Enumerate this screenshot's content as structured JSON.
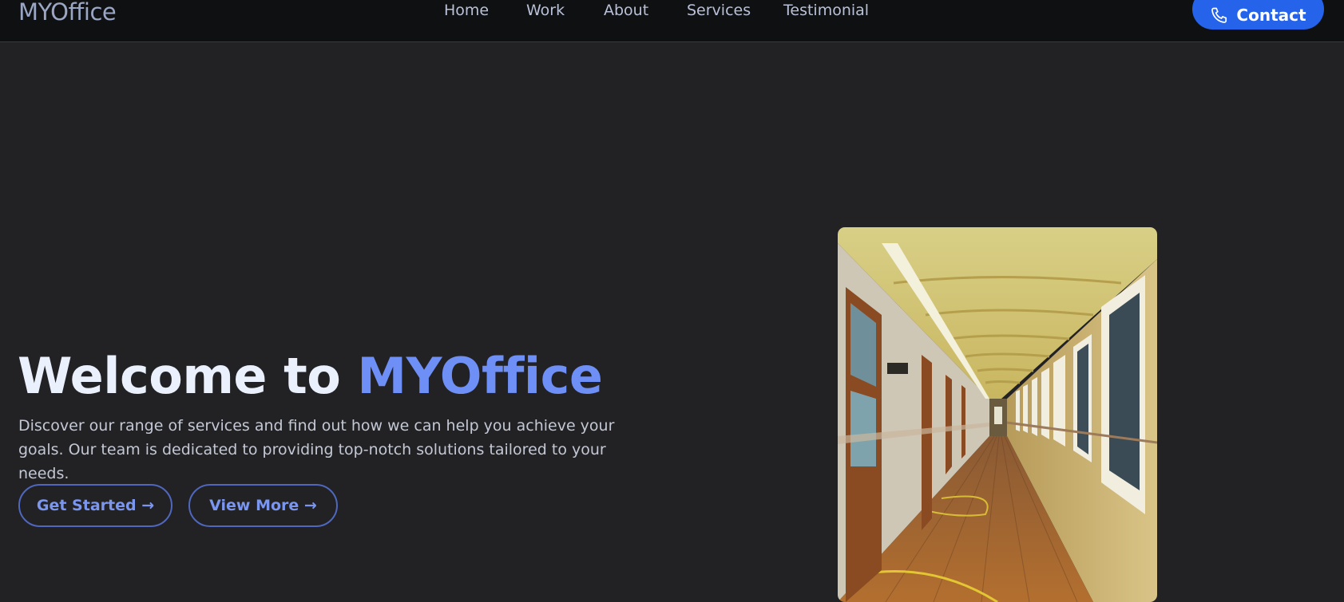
{
  "header": {
    "brand": "MYOffice",
    "nav": [
      {
        "label": "Home"
      },
      {
        "label": "Work"
      },
      {
        "label": "About"
      },
      {
        "label": "Services"
      },
      {
        "label": "Testimonial"
      }
    ],
    "contact_label": "Contact",
    "contact_icon": "phone-icon"
  },
  "hero": {
    "title_prefix": "Welcome to ",
    "title_highlight": "MYOffice",
    "description": "Discover our range of services and find out how we can help you achieve your goals. Our team is dedicated to providing top-notch solutions tailored to your needs.",
    "buttons": [
      {
        "label": "Get Started →"
      },
      {
        "label": "View More →"
      }
    ],
    "image_subject": "school-corridor-photo"
  },
  "colors": {
    "background": "#222225",
    "navbar": "#0f1011",
    "accent": "#2563eb",
    "highlight": "#6e8ff5"
  }
}
